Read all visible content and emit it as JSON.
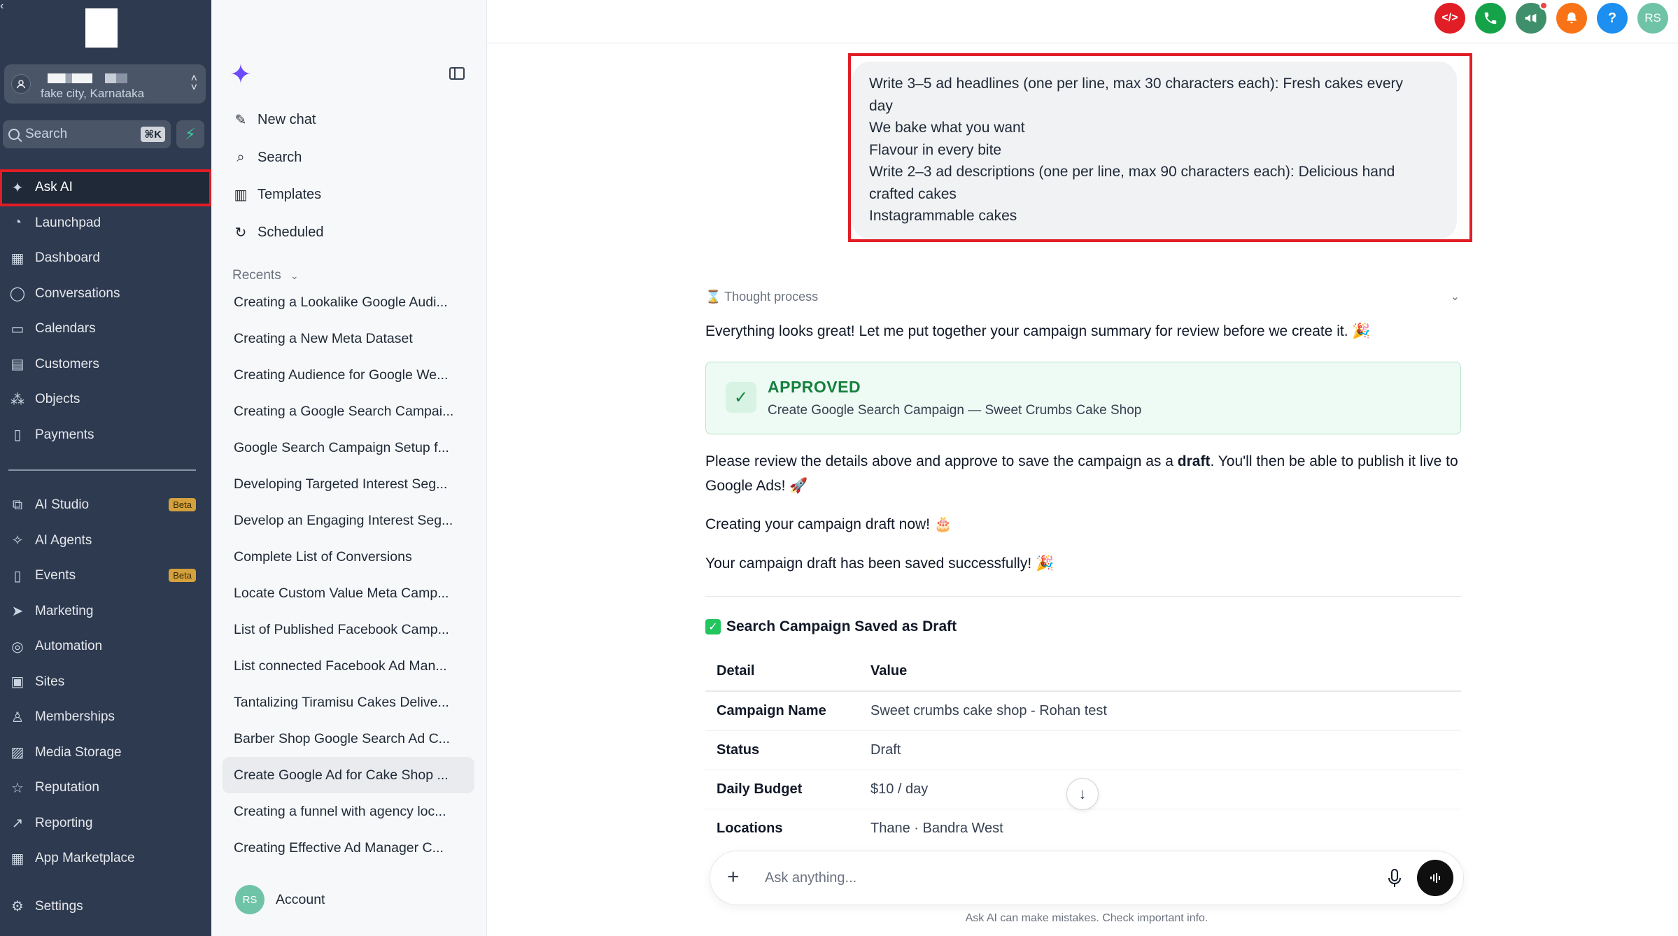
{
  "nav": {
    "location_sub": "fake city, Karnataka",
    "search_label": "Search",
    "search_shortcut": "⌘K",
    "items_top": [
      {
        "label": "Ask AI",
        "icon": "sparkle-icon",
        "active": true
      },
      {
        "label": "Launchpad",
        "icon": "rocket-icon"
      },
      {
        "label": "Dashboard",
        "icon": "grid-icon"
      },
      {
        "label": "Conversations",
        "icon": "chat-icon"
      },
      {
        "label": "Calendars",
        "icon": "calendar-icon"
      },
      {
        "label": "Customers",
        "icon": "contacts-icon"
      },
      {
        "label": "Objects",
        "icon": "objects-icon"
      },
      {
        "label": "Payments",
        "icon": "receipt-icon"
      }
    ],
    "items_bottom": [
      {
        "label": "AI Studio",
        "icon": "ai-studio-icon",
        "badge": "Beta"
      },
      {
        "label": "AI Agents",
        "icon": "agents-icon"
      },
      {
        "label": "Events",
        "icon": "events-icon",
        "badge": "Beta"
      },
      {
        "label": "Marketing",
        "icon": "send-icon"
      },
      {
        "label": "Automation",
        "icon": "automation-icon"
      },
      {
        "label": "Sites",
        "icon": "sites-icon"
      },
      {
        "label": "Memberships",
        "icon": "membership-icon"
      },
      {
        "label": "Media Storage",
        "icon": "media-icon"
      },
      {
        "label": "Reputation",
        "icon": "star-icon"
      },
      {
        "label": "Reporting",
        "icon": "trend-icon"
      },
      {
        "label": "App Marketplace",
        "icon": "apps-icon"
      }
    ],
    "settings": "Settings"
  },
  "side": {
    "menu": [
      {
        "label": "New chat",
        "icon": "edit-icon"
      },
      {
        "label": "Search",
        "icon": "search-icon"
      },
      {
        "label": "Templates",
        "icon": "book-icon"
      },
      {
        "label": "Scheduled",
        "icon": "schedule-icon"
      }
    ],
    "recents_label": "Recents",
    "recents": [
      "Creating a Lookalike Google Audi...",
      "Creating a New Meta Dataset",
      "Creating Audience for Google We...",
      "Creating a Google Search Campai...",
      "Google Search Campaign Setup f...",
      "Developing Targeted Interest Seg...",
      "Develop an Engaging Interest Seg...",
      "Complete List of Conversions",
      "Locate Custom Value Meta Camp...",
      "List of Published Facebook Camp...",
      "List connected Facebook Ad Man...",
      "Tantalizing Tiramisu Cakes Delive...",
      "Barber Shop Google Search Ad C...",
      "Create Google Ad for Cake Shop ...",
      "Creating a funnel with agency loc...",
      "Creating Effective Ad Manager C..."
    ],
    "active_recent_index": 13,
    "account_initials": "RS",
    "account_label": "Account"
  },
  "topbar": {
    "buttons": [
      {
        "name": "code-icon",
        "glyph": "</>",
        "color": "#e11d26"
      },
      {
        "name": "phone-icon",
        "glyph": "✆",
        "color": "#15a34a"
      },
      {
        "name": "megaphone-icon",
        "glyph": "📢",
        "color": "#3f8f6b"
      },
      {
        "name": "bell-icon",
        "glyph": "🔔",
        "color": "#f97316"
      },
      {
        "name": "help-icon",
        "glyph": "?",
        "color": "#1d8ff0"
      },
      {
        "name": "profile-avatar",
        "glyph": "RS",
        "color": "#6fc3a6"
      }
    ]
  },
  "chat": {
    "user_message_lines": [
      "Write 3–5 ad headlines (one per line, max 30 characters each): Fresh cakes every",
      "day",
      "We bake what you want",
      "Flavour in every bite",
      "Write 2–3 ad descriptions (one per line, max 90 characters each): Delicious hand",
      "crafted cakes",
      "Instagrammable cakes"
    ],
    "thought_label": "Thought process",
    "intro": "Everything looks great! Let me put together your campaign summary for review before we create it. 🎉",
    "approved_title": "APPROVED",
    "approved_sub": "Create Google Search Campaign — Sweet Crumbs Cake Shop",
    "review_pre": "Please review the details above and approve to save the campaign as a ",
    "review_bold": "draft",
    "review_post": ". You'll then be able to publish it live to Google Ads! 🚀",
    "creating": "Creating your campaign draft now! 🎂",
    "saved": "Your campaign draft has been saved successfully! 🎉",
    "section_title": "Search Campaign Saved as Draft",
    "table_headers": [
      "Detail",
      "Value"
    ],
    "table_rows": [
      [
        "Campaign Name",
        "Sweet crumbs cake shop - Rohan test"
      ],
      [
        "Status",
        "Draft"
      ],
      [
        "Daily Budget",
        "$10 / day"
      ],
      [
        "Locations",
        "Thane · Bandra West"
      ]
    ],
    "composer_placeholder": "Ask anything...",
    "disclaimer": "Ask AI can make mistakes. Check important info."
  }
}
